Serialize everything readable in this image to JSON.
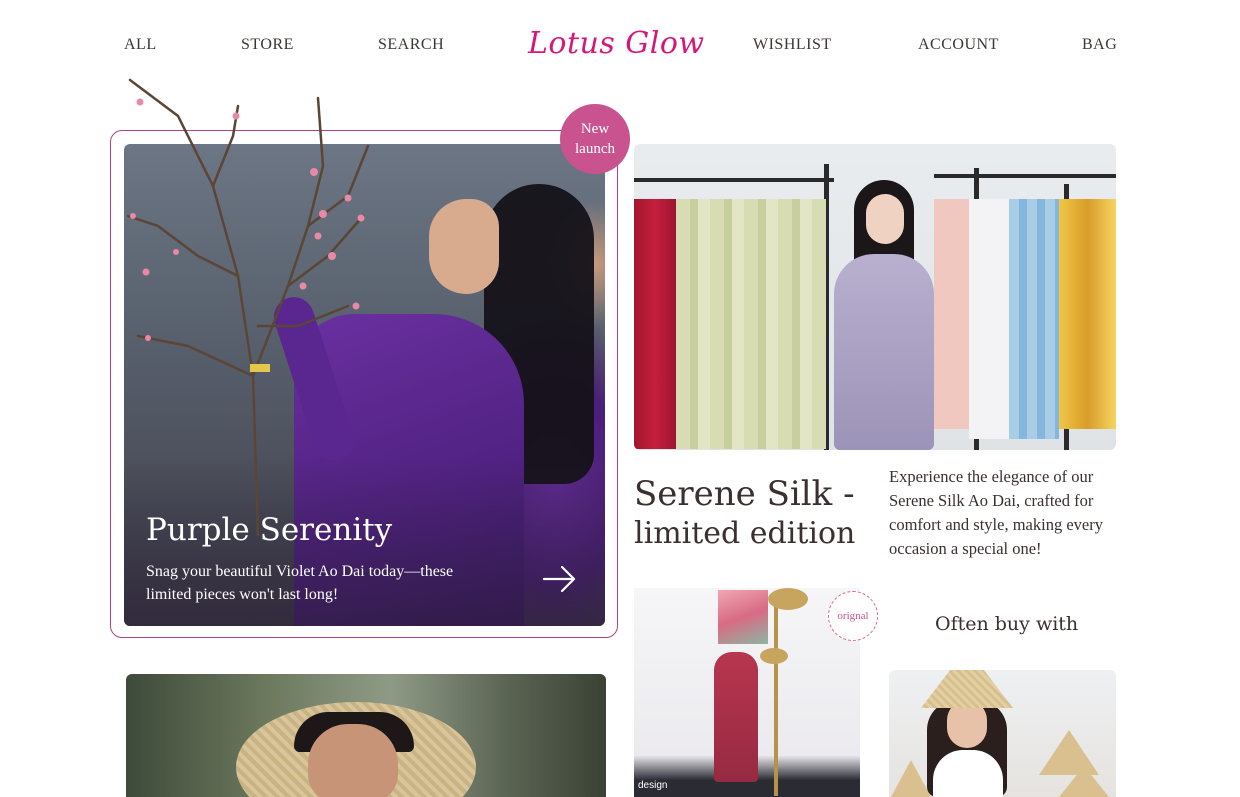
{
  "nav": {
    "left": [
      "ALL",
      "STORE",
      "SEARCH"
    ],
    "logo": "Lotus Glow",
    "right": [
      "WISHLIST",
      "ACCOUNT",
      "BAG"
    ]
  },
  "hero": {
    "badge_line1": "New",
    "badge_line2": "launch",
    "title": "Purple Serenity",
    "text": "Snag your beautiful Violet Ao Dai today—these limited pieces won't last long!"
  },
  "feature": {
    "title": "Serene Silk -",
    "subtitle": "limited edition",
    "description": "Experience the elegance of our Serene Silk Ao Dai, crafted for comfort and style, making every occasion a special one!"
  },
  "product": {
    "badge": "orignal",
    "watermark": "design"
  },
  "often_buy": {
    "title": "Often buy with"
  },
  "colors": {
    "brand": "#d6177a",
    "badge": "#c8538f",
    "frame": "#b0407e"
  }
}
